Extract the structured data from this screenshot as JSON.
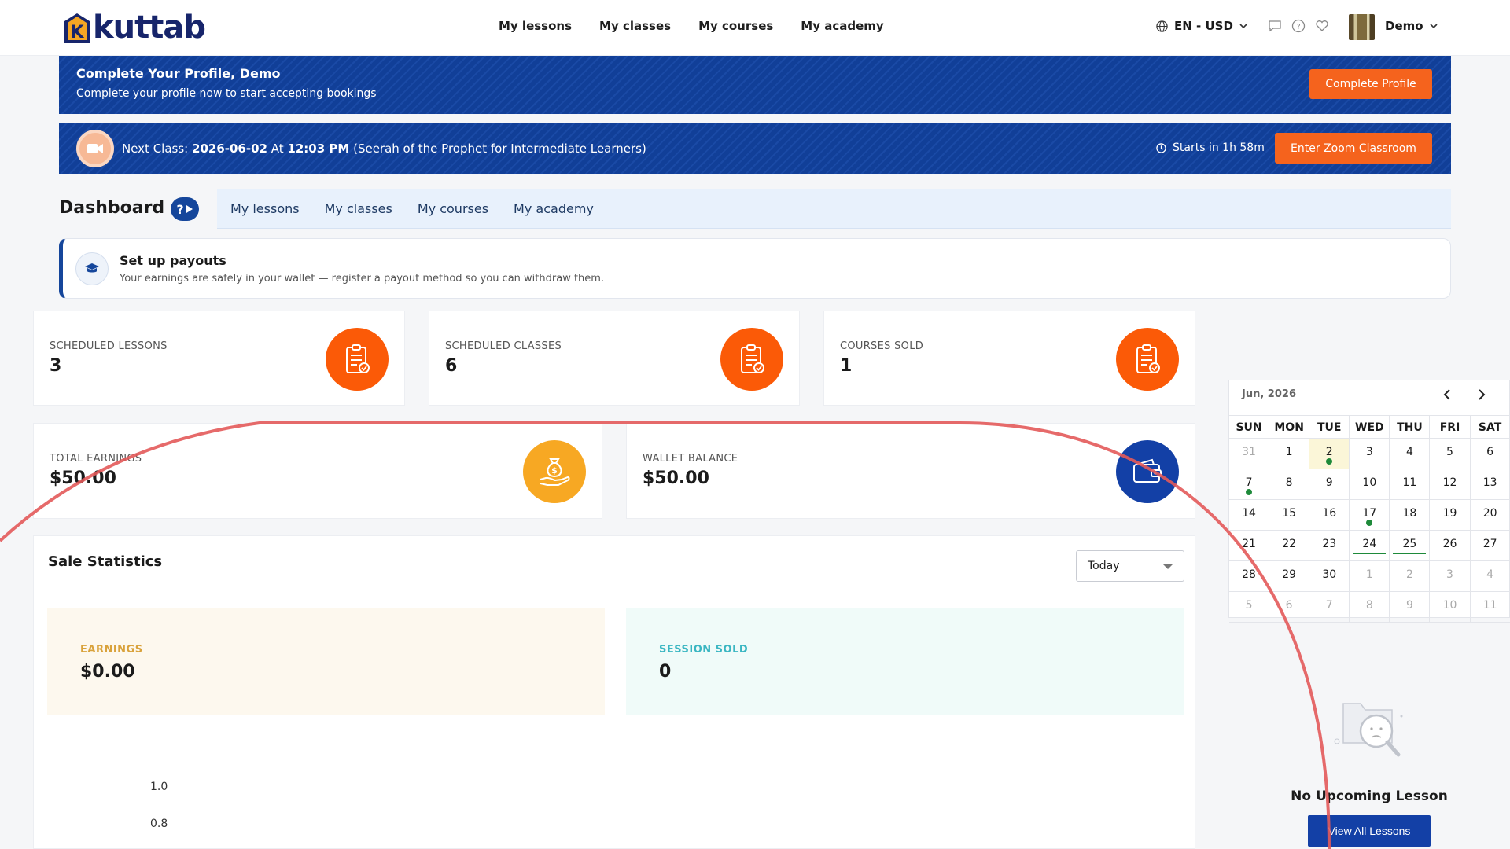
{
  "header": {
    "logo_text": "kuttab",
    "logo_letter": "K",
    "nav": [
      "My lessons",
      "My classes",
      "My courses",
      "My academy"
    ],
    "language": "EN - USD",
    "user": "Demo"
  },
  "profile_banner": {
    "title": "Complete Your Profile, Demo",
    "subtitle": "Complete your profile now to start accepting bookings",
    "button": "Complete Profile"
  },
  "next_class": {
    "label": "Next Class:",
    "date": "2026-06-02",
    "at": "At",
    "time": "12:03 PM",
    "course": "(Seerah of the Prophet for Intermediate Learners)",
    "starts": "Starts in 1h 58m",
    "button": "Enter Zoom Classroom"
  },
  "dashboard": {
    "title": "Dashboard",
    "help": "?",
    "tabs": [
      "My lessons",
      "My classes",
      "My courses",
      "My academy"
    ]
  },
  "payout": {
    "title": "Set up payouts",
    "subtitle": "Your earnings are safely in your wallet — register a payout method so you can withdraw them."
  },
  "stats": [
    {
      "label": "SCHEDULED LESSONS",
      "value": "3"
    },
    {
      "label": "SCHEDULED CLASSES",
      "value": "6"
    },
    {
      "label": "COURSES SOLD",
      "value": "1"
    },
    {
      "label": "TOTAL EARNINGS",
      "value": "$50.00"
    },
    {
      "label": "WALLET BALANCE",
      "value": "$50.00"
    }
  ],
  "sale_statistics": {
    "title": "Sale Statistics",
    "period": "Today",
    "earnings_label": "EARNINGS",
    "earnings_value": "$0.00",
    "sessions_label": "SESSION SOLD",
    "sessions_value": "0",
    "y_ticks": [
      "1.0",
      "0.8"
    ]
  },
  "calendar": {
    "month": "Jun, 2026",
    "days": [
      "SUN",
      "MON",
      "TUE",
      "WED",
      "THU",
      "FRI",
      "SAT"
    ],
    "weeks": [
      [
        "31",
        "1",
        "2",
        "3",
        "4",
        "5",
        "6"
      ],
      [
        "7",
        "8",
        "9",
        "10",
        "11",
        "12",
        "13"
      ],
      [
        "14",
        "15",
        "16",
        "17",
        "18",
        "19",
        "20"
      ],
      [
        "21",
        "22",
        "23",
        "24",
        "25",
        "26",
        "27"
      ],
      [
        "28",
        "29",
        "30",
        "1",
        "2",
        "3",
        "4"
      ],
      [
        "5",
        "6",
        "7",
        "8",
        "9",
        "10",
        "11"
      ]
    ]
  },
  "upcoming": {
    "empty_title": "No Upcoming Lesson",
    "button": "View All Lessons"
  },
  "colors": {
    "brand_blue": "#15469b",
    "accent_orange": "#f5631d",
    "gold": "#f7a823",
    "green": "#1e8a3a"
  }
}
